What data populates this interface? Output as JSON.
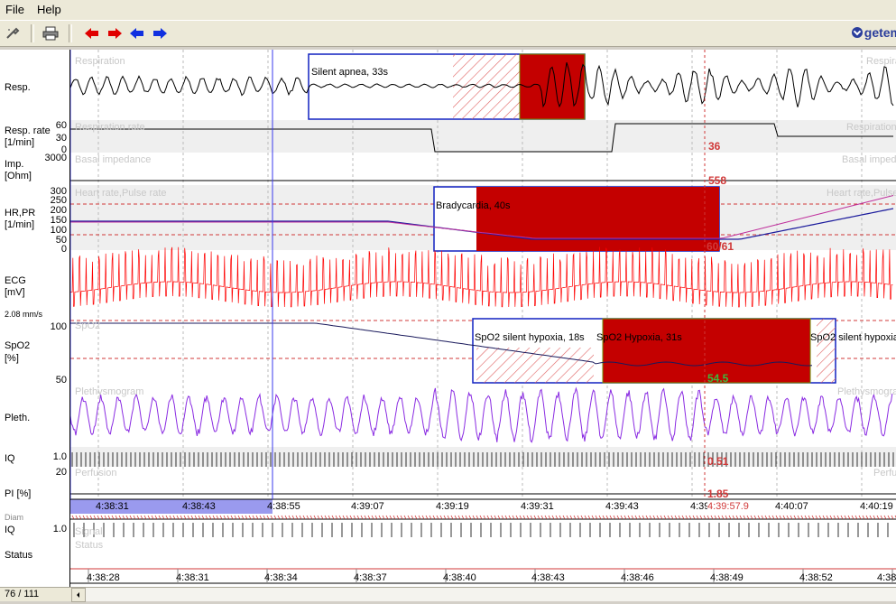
{
  "menu": {
    "file": "File",
    "help": "Help"
  },
  "brand": {
    "name": "getem"
  },
  "channels": {
    "resp": {
      "label": "Resp.",
      "bg_label": "Respiration"
    },
    "resp_rate": {
      "label": "Resp. rate",
      "unit": "[1/min]",
      "bg_label": "Respiration rate",
      "scale": [
        "60",
        "30",
        "0"
      ],
      "value": "36"
    },
    "imp": {
      "label": "Imp.",
      "unit": "[Ohm]",
      "bg_label": "Basal impedance",
      "scale_top": "3000",
      "value": "558"
    },
    "hr": {
      "label": "HR,PR",
      "unit": "[1/min]",
      "bg_label": "Heart rate,Pulse rate",
      "scale": [
        "300",
        "250",
        "200",
        "150",
        "100",
        "50",
        "0"
      ],
      "value": "60/61"
    },
    "ecg": {
      "label": "ECG",
      "unit": "[mV]",
      "speed": "2.08 mm/s"
    },
    "spo2": {
      "label": "SpO2",
      "unit": "[%]",
      "bg_label": "SpO2",
      "scale": [
        "100",
        "50"
      ],
      "value": "54.5"
    },
    "pleth": {
      "label": "Pleth.",
      "bg_label": "Plethysmogram"
    },
    "iq": {
      "label": "IQ",
      "scale": "1.0",
      "value": "0.51"
    },
    "pi": {
      "label": "PI [%]",
      "bg_label": "Perfusion",
      "scale": "20",
      "value": "1.85"
    }
  },
  "events": {
    "apnea": "Silent apnea, 33s",
    "brady": "Bradycardia, 40s",
    "hypoxia_silent": "SpO2 silent hypoxia, 18s",
    "hypoxia": "SpO2 Hypoxia, 31s",
    "hypoxia_silent2": "SpO2 silent hypoxia"
  },
  "timeline_top": [
    "4:38:31",
    "4:38:43",
    "4:38:55",
    "4:39:07",
    "4:39:19",
    "4:39:31",
    "4:39:43",
    "4:39:",
    "4:40:07",
    "4:40:19"
  ],
  "cursor_time": "4:39:57.9",
  "lower": {
    "iq_label": "IQ",
    "iq_scale": "1.0",
    "status_label": "Status",
    "signal_bg": "Signal",
    "status_bg": "Status",
    "top_label": "Diam"
  },
  "timeline_bottom": [
    "4:38:28",
    "4:38:31",
    "4:38:34",
    "4:38:37",
    "4:38:40",
    "4:38:43",
    "4:38:46",
    "4:38:49",
    "4:38:52",
    "4:38:"
  ],
  "status_bar": {
    "page": "76 / 111"
  },
  "colors": {
    "event_red": "#c40000",
    "pleth": "#8a2be2",
    "ecg": "#ff0000",
    "cursor": "#d03838",
    "selection": "#9a9aee"
  }
}
